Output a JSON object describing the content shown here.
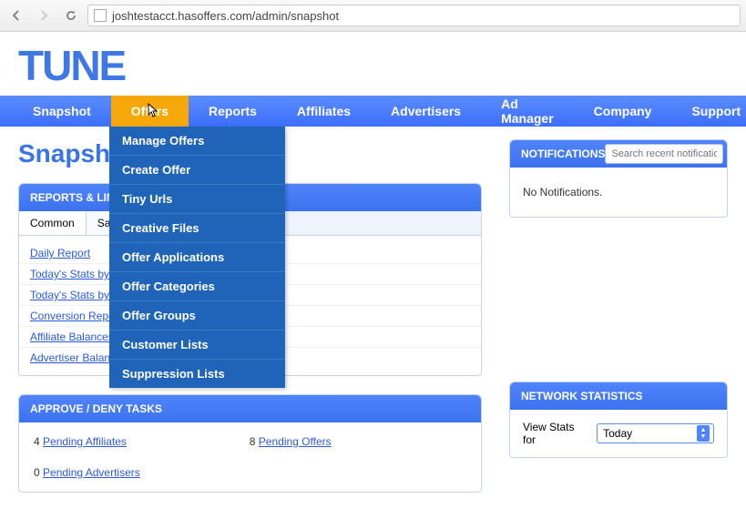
{
  "browser": {
    "url": "joshtestacct.hasoffers.com/admin/snapshot"
  },
  "logo": "TUNE",
  "nav": {
    "items": [
      "Snapshot",
      "Offers",
      "Reports",
      "Affiliates",
      "Advertisers",
      "Ad Manager",
      "Company",
      "Support"
    ],
    "active_index": 1
  },
  "dropdown": {
    "items": [
      "Manage Offers",
      "Create Offer",
      "Tiny Urls",
      "Creative Files",
      "Offer Applications",
      "Offer Categories",
      "Offer Groups",
      "Customer Lists",
      "Suppression Lists"
    ]
  },
  "page_title": "Snapshot",
  "reports_panel": {
    "title": "REPORTS & LINKS",
    "tabs": [
      "Common",
      "Saved"
    ],
    "active_tab": 0,
    "links": [
      "Daily Report",
      "Today's Stats by Offer",
      "Today's Stats by Affiliate",
      "Conversion Report",
      "Affiliate Balances",
      "Advertiser Balances"
    ]
  },
  "tasks_panel": {
    "title": "APPROVE / DENY TASKS",
    "left": [
      {
        "count": "4",
        "label": "Pending Affiliates"
      },
      {
        "count": "0",
        "label": "Pending Advertisers"
      }
    ],
    "right": [
      {
        "count": "8",
        "label": "Pending Offers"
      }
    ]
  },
  "notifications": {
    "title": "NOTIFICATIONS",
    "search_placeholder": "Search recent notifications",
    "empty_text": "No Notifications."
  },
  "stats": {
    "title": "NETWORK STATISTICS",
    "label": "View Stats for",
    "selected": "Today"
  }
}
